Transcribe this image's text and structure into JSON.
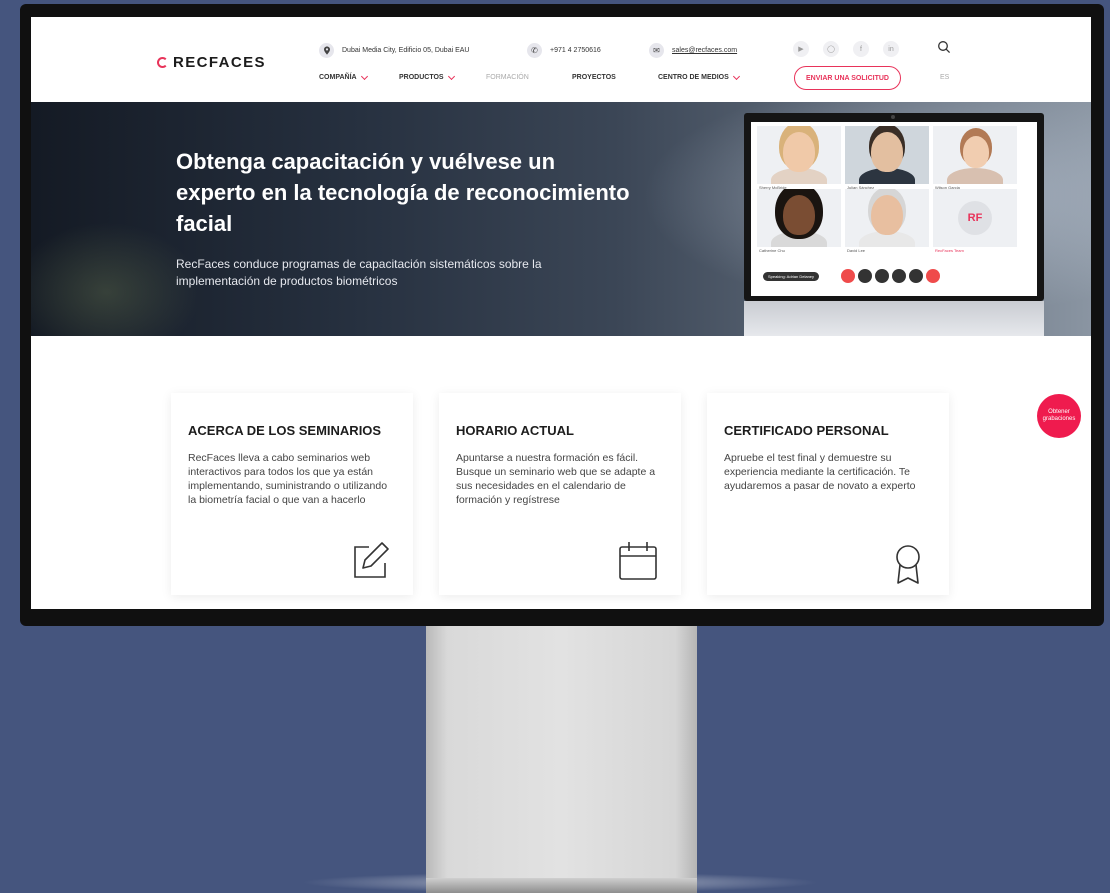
{
  "brand": {
    "logo_text": "RECFACES",
    "accent": "#e8335a"
  },
  "contacts": {
    "address": "Dubai Media City, Edificio 05, Dubai EAU",
    "phone": "+971 4 2750616",
    "email": "sales@recfaces.com"
  },
  "socials": [
    "youtube-icon",
    "instagram-icon",
    "facebook-icon",
    "linkedin-icon"
  ],
  "nav": {
    "items": [
      {
        "label": "COMPAÑÍA",
        "dropdown": true
      },
      {
        "label": "PRODUCTOS",
        "dropdown": true
      },
      {
        "label": "FORMACIÓN",
        "dropdown": false,
        "active": true
      },
      {
        "label": "PROYECTOS",
        "dropdown": false
      },
      {
        "label": "CENTRO DE MEDIOS",
        "dropdown": true
      }
    ],
    "cta": "ENVIAR UNA SOLICITUD",
    "lang": "ES"
  },
  "hero": {
    "title": "Obtenga capacitación y vuélvese un experto en la tecnología de reconocimiento facial",
    "subtitle": "RecFaces conduce programas de capacitación sistemáticos sobre la implementación de productos biométricos",
    "video_call": {
      "tile_labels": [
        "Sherry McBride",
        "Julian Sánchez",
        "Wilson Garcia",
        "Catherine Chu",
        "David Lee",
        "RecFaces Team"
      ],
      "avatar_initials": "RF",
      "speaking": "Speaking: Adrian Delaney"
    }
  },
  "cards": [
    {
      "title": "ACERCA DE LOS SEMINARIOS",
      "text": "RecFaces lleva a cabo seminarios web interactivos para todos los que ya están implementando, suministrando o utilizando la biometría facial o que van a hacerlo",
      "icon": "edit-icon"
    },
    {
      "title": "HORARIO ACTUAL",
      "text": "Apuntarse a nuestra formación es fácil. Busque un seminario web que se adapte a sus necesidades en el calendario de formación y regístrese",
      "icon": "calendar-icon"
    },
    {
      "title": "CERTIFICADO PERSONAL",
      "text": "Apruebe el test final y demuestre su experiencia mediante la certificación. Te ayudaremos a pasar de novato a experto",
      "icon": "award-icon"
    }
  ],
  "fab": {
    "label": "Obtener grabaciones",
    "color": "#ef1b4e"
  }
}
